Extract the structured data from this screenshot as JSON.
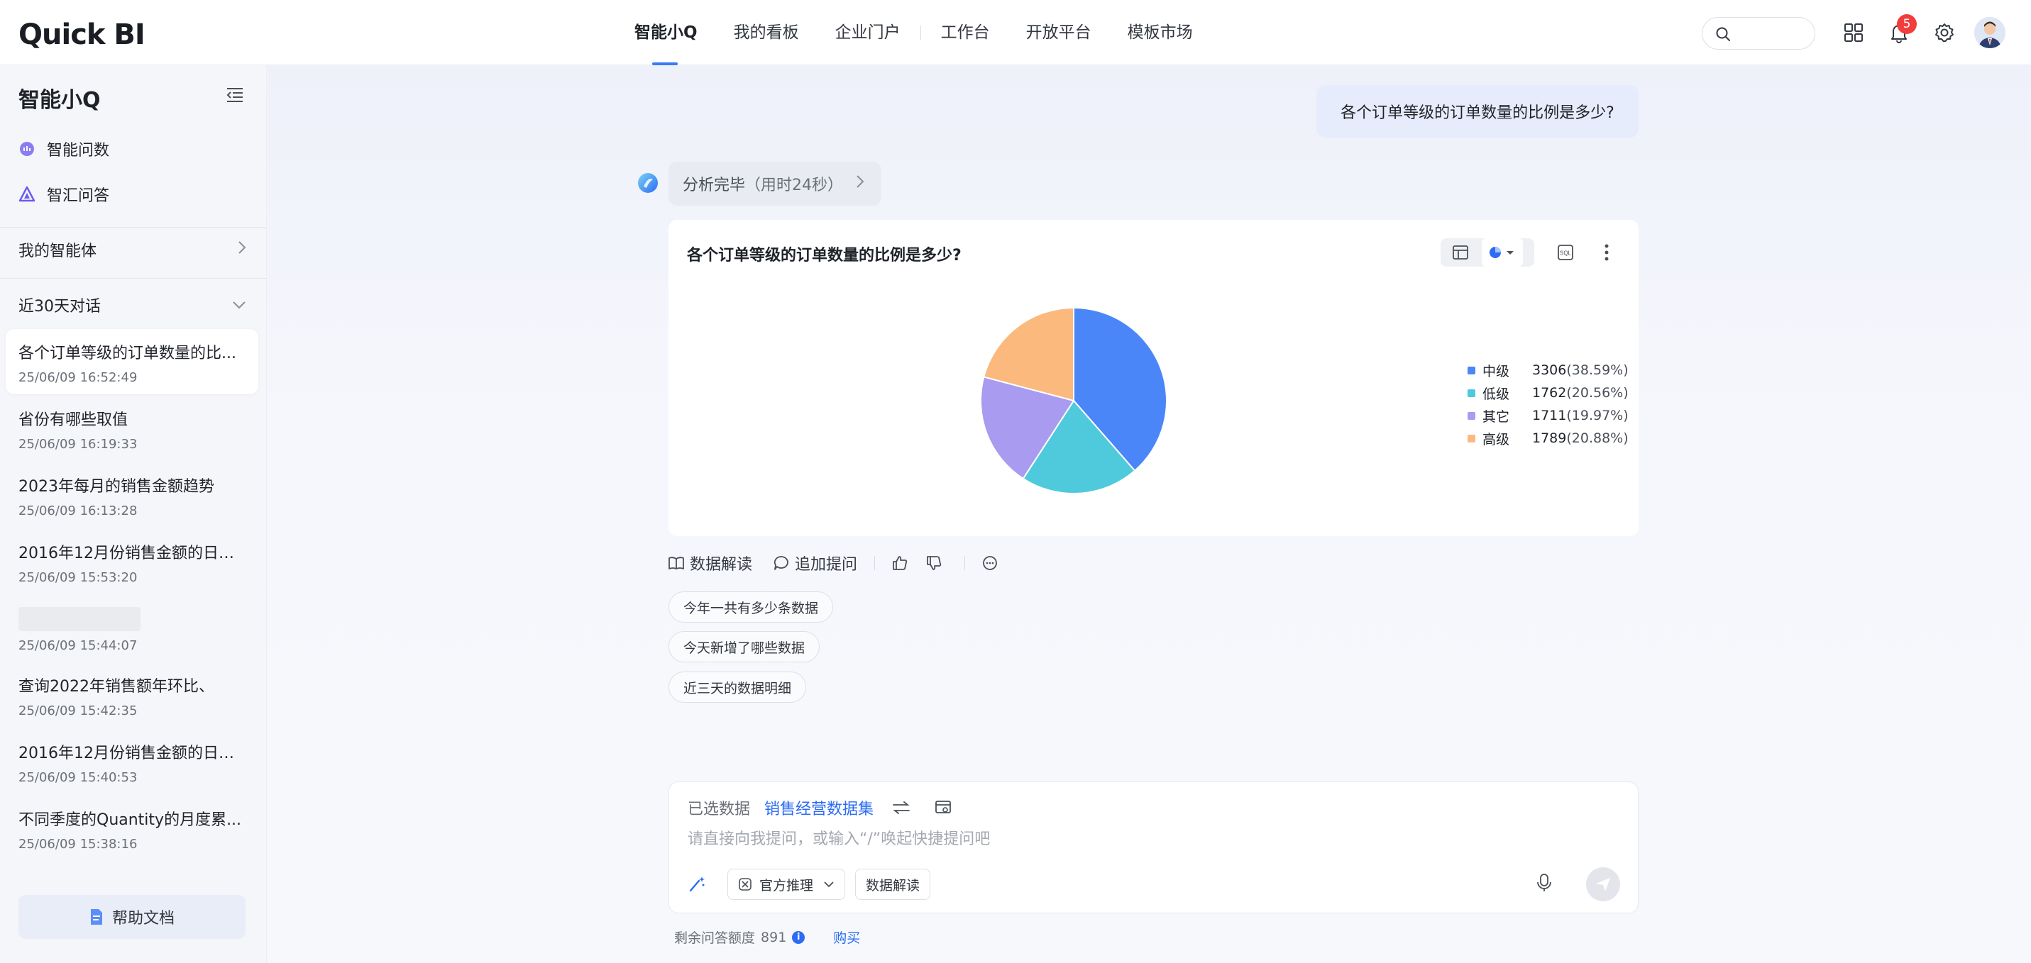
{
  "app": {
    "logo": "Quick BI"
  },
  "nav": {
    "items": [
      "智能小Q",
      "我的看板",
      "企业门户",
      "工作台",
      "开放平台",
      "模板市场"
    ],
    "active_index": 0
  },
  "header": {
    "notification_count": "5"
  },
  "sidebar": {
    "title": "智能小Q",
    "menu": [
      {
        "label": "智能问数",
        "icon": "chat-data-icon"
      },
      {
        "label": "智汇问答",
        "icon": "triangle-qa-icon"
      }
    ],
    "agents_label": "我的智能体",
    "recent_label": "近30天对话",
    "conversations": [
      {
        "title": "各个订单等级的订单数量的比...",
        "date": "25/06/09 16:52:49",
        "active": true
      },
      {
        "title": "省份有哪些取值",
        "date": "25/06/09 16:19:33"
      },
      {
        "title": "2023年每月的销售金额趋势",
        "date": "25/06/09 16:13:28"
      },
      {
        "title": "2016年12月份销售金额的日环...",
        "date": "25/06/09 15:53:20"
      },
      {
        "title": "",
        "date": "25/06/09 15:44:07"
      },
      {
        "title": "查询2022年销售额年环比、",
        "date": "25/06/09 15:42:35"
      },
      {
        "title": "2016年12月份销售金额的日环...",
        "date": "25/06/09 15:40:53"
      },
      {
        "title": "不同季度的Quantity的月度累...",
        "date": "25/06/09 15:38:16"
      }
    ],
    "help_label": "帮助文档"
  },
  "chat": {
    "user_question": "各个订单等级的订单数量的比例是多少?",
    "status": {
      "text": "分析完毕",
      "duration": "（用时24秒）"
    },
    "card_title": "各个订单等级的订单数量的比例是多少?",
    "actions": {
      "interpret": "数据解读",
      "followup": "追加提问"
    },
    "suggestions": [
      "今年一共有多少条数据",
      "今天新增了哪些数据",
      "近三天的数据明细"
    ]
  },
  "chart_data": {
    "type": "pie",
    "title": "各个订单等级的订单数量的比例是多少?",
    "legend_position": "right",
    "slices": [
      {
        "name": "中级",
        "value": 3306,
        "percent": "(38.59%)",
        "color": "#4a86f7"
      },
      {
        "name": "低级",
        "value": 1762,
        "percent": "(20.56%)",
        "color": "#4ecadc"
      },
      {
        "name": "其它",
        "value": 1711,
        "percent": "(19.97%)",
        "color": "#a89bf0"
      },
      {
        "name": "高级",
        "value": 1789,
        "percent": "(20.88%)",
        "color": "#fbb97d"
      }
    ]
  },
  "input": {
    "selected_label": "已选数据",
    "dataset": "销售经营数据集",
    "placeholder": "请直接向我提问，或输入“/”唤起快捷提问吧",
    "recommend_label": "官方推理",
    "interpret_label": "数据解读"
  },
  "footer": {
    "quota_label": "剩余问答额度",
    "quota_value": "891",
    "buy_label": "购买"
  },
  "colors": {
    "accent": "#3a7bf6",
    "link": "#2b6cf2"
  }
}
